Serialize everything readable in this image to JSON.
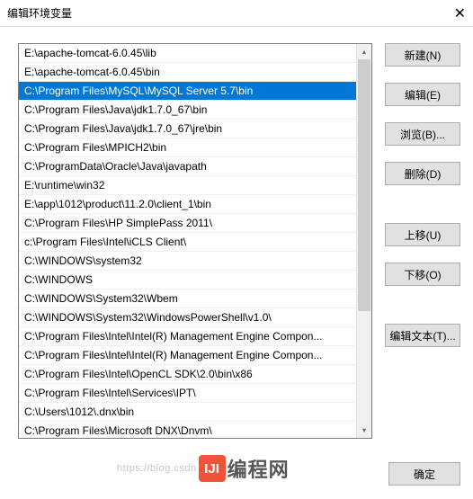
{
  "title": "编辑环境变量",
  "close_symbol": "✕",
  "list": {
    "selected_index": 2,
    "items": [
      "E:\\apache-tomcat-6.0.45\\lib",
      "E:\\apache-tomcat-6.0.45\\bin",
      "C:\\Program Files\\MySQL\\MySQL Server 5.7\\bin",
      "C:\\Program Files\\Java\\jdk1.7.0_67\\bin",
      "C:\\Program Files\\Java\\jdk1.7.0_67\\jre\\bin",
      "C:\\Program Files\\MPICH2\\bin",
      "C:\\ProgramData\\Oracle\\Java\\javapath",
      "E:\\runtime\\win32",
      "E:\\app\\1012\\product\\11.2.0\\client_1\\bin",
      "C:\\Program Files\\HP SimplePass 2011\\",
      "c:\\Program Files\\Intel\\iCLS Client\\",
      "C:\\WINDOWS\\system32",
      "C:\\WINDOWS",
      "C:\\WINDOWS\\System32\\Wbem",
      "C:\\WINDOWS\\System32\\WindowsPowerShell\\v1.0\\",
      "C:\\Program Files\\Intel\\Intel(R) Management Engine Compon...",
      "C:\\Program Files\\Intel\\Intel(R) Management Engine Compon...",
      "C:\\Program Files\\Intel\\OpenCL SDK\\2.0\\bin\\x86",
      "C:\\Program Files\\Intel\\Services\\IPT\\",
      "C:\\Users\\1012\\.dnx\\bin",
      "C:\\Program Files\\Microsoft DNX\\Dnvm\\"
    ]
  },
  "buttons": {
    "new": "新建(N)",
    "edit": "编辑(E)",
    "browse": "浏览(B)...",
    "delete": "删除(D)",
    "moveup": "上移(U)",
    "movedown": "下移(O)",
    "edittext": "编辑文本(T)...",
    "ok": "确定"
  },
  "watermark": {
    "url_prefix": "https://blog.csdn",
    "logo_text": "IJI",
    "brand": "编程网"
  }
}
